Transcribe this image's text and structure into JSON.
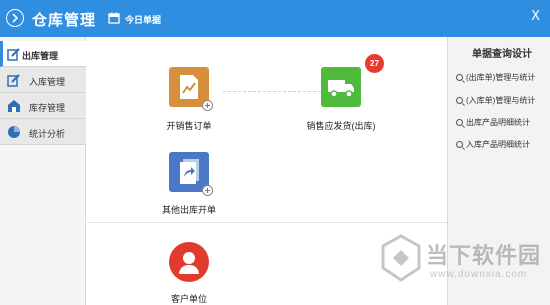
{
  "titlebar": {
    "title": "仓库管理",
    "today_label": "今日单据",
    "close_label": "X"
  },
  "sidebar": {
    "items": [
      {
        "label": "出库管理",
        "icon": "edit-icon",
        "active": true
      },
      {
        "label": "入库管理",
        "icon": "edit-icon",
        "active": false
      },
      {
        "label": "库存管理",
        "icon": "warehouse-icon",
        "active": false
      },
      {
        "label": "统计分析",
        "icon": "pie-chart-icon",
        "active": false
      }
    ]
  },
  "main": {
    "tiles": [
      {
        "label": "开销售订单",
        "icon": "document-chart-icon",
        "color": "#d68f3d"
      },
      {
        "label": "销售应发货(出库)",
        "icon": "truck-icon",
        "color": "#4fba3b",
        "badge": "27"
      },
      {
        "label": "其他出库开单",
        "icon": "forward-document-icon",
        "color": "#4a78c6"
      },
      {
        "label": "客户单位",
        "icon": "customer-icon",
        "color": "#e03b2c"
      }
    ]
  },
  "rpanel": {
    "title": "单据查询设计",
    "items": [
      {
        "label": "(出库单)管理与统计"
      },
      {
        "label": "(入库单)管理与统计"
      },
      {
        "label": "出库产品明细统计"
      },
      {
        "label": "入库产品明细统计"
      }
    ]
  },
  "watermark": {
    "name": "当下软件园",
    "url": "www.downxia.com"
  },
  "colors": {
    "titlebar": "#2f8ee0",
    "badge": "#e83a2e"
  }
}
